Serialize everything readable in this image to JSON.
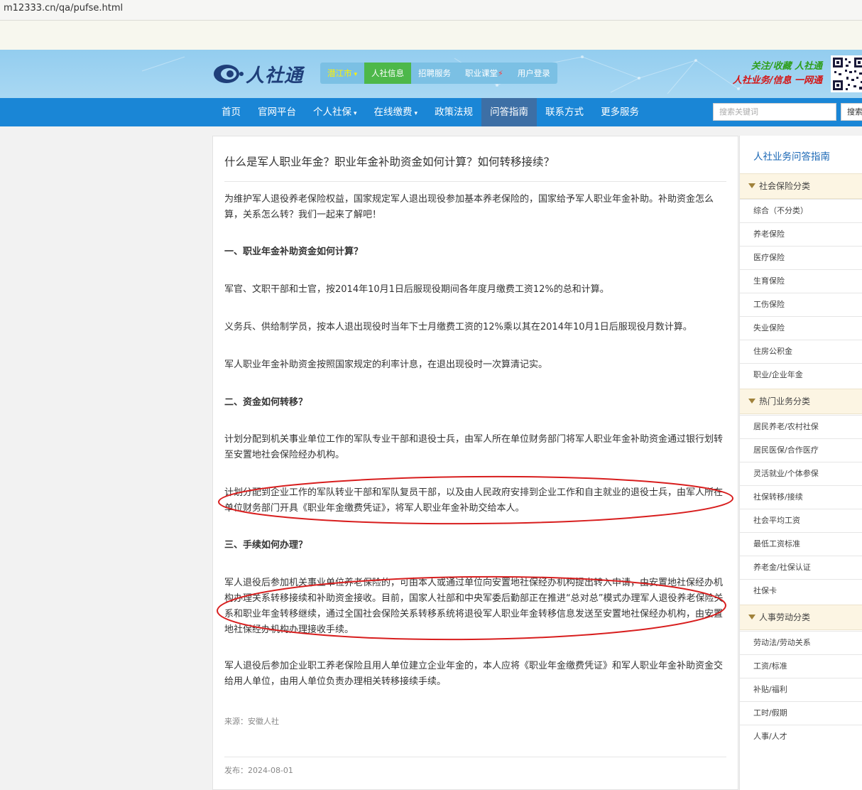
{
  "browser": {
    "url": "m12333.cn/qa/pufse.html"
  },
  "header": {
    "logo_text": "人社通",
    "top_nav": [
      {
        "label": "潜江市"
      },
      {
        "label": "人社信息"
      },
      {
        "label": "招聘服务"
      },
      {
        "label": "职业课堂"
      },
      {
        "label": "用户登录"
      }
    ],
    "slogan_line1": "关注/收藏 人社通",
    "slogan_line2": "人社业务/信息 一网通"
  },
  "nav": {
    "items": [
      {
        "label": "首页"
      },
      {
        "label": "官网平台"
      },
      {
        "label": "个人社保"
      },
      {
        "label": "在线缴费"
      },
      {
        "label": "政策法规"
      },
      {
        "label": "问答指南"
      },
      {
        "label": "联系方式"
      },
      {
        "label": "更多服务"
      }
    ],
    "search_placeholder": "搜索关键词",
    "search_button": "搜索"
  },
  "article": {
    "title": "什么是军人职业年金？职业年金补助资金如何计算？如何转移接续？",
    "intro": "为维护军人退役养老保险权益，国家规定军人退出现役参加基本养老保险的，国家给予军人职业年金补助。补助资金怎么算，关系怎么转？我们一起来了解吧！",
    "heading1": "一、职业年金补助资金如何计算？",
    "p1": "军官、文职干部和士官，按2014年10月1日后服现役期间各年度月缴费工资12%的总和计算。",
    "p2": "义务兵、供给制学员，按本人退出现役时当年下士月缴费工资的12%乘以其在2014年10月1日后服现役月数计算。",
    "p3": "军人职业年金补助资金按照国家规定的利率计息，在退出现役时一次算清记实。",
    "heading2": "二、资金如何转移？",
    "p4": "计划分配到机关事业单位工作的军队专业干部和退役士兵，由军人所在单位财务部门将军人职业年金补助资金通过银行划转至安置地社会保险经办机构。",
    "p5": "计划分配到企业工作的军队转业干部和军队复员干部，以及由人民政府安排到企业工作和自主就业的退役士兵，由军人所在单位财务部门开具《职业年金缴费凭证》，将军人职业年金补助交给本人。",
    "heading3": "三、手续如何办理？",
    "p6": "军人退役后参加机关事业单位养老保险的，可由本人或通过单位向安置地社保经办机构提出转入申请，由安置地社保经办机构办理关系转移接续和补助资金接收。目前，国家人社部和中央军委后勤部正在推进“总对总”模式办理军人退役养老保险关系和职业年金转移继续，通过全国社会保险关系转移系统将退役军人职业年金转移信息发送至安置地社保经办机构，由安置地社保经办机构办理接收手续。",
    "p7": "军人退役后参加企业职工养老保险且用人单位建立企业年金的，本人应将《职业年金缴费凭证》和军人职业年金补助资金交给用人单位，由用人单位负责办理相关转移接续手续。",
    "source": "来源：安徽人社",
    "date": "发布：2024-08-01"
  },
  "sidebar": {
    "title": "人社业务问答指南",
    "cat1": "社会保险分类",
    "cat1_items": [
      "综合（不分类）",
      "养老保险",
      "医疗保险",
      "生育保险",
      "工伤保险",
      "失业保险",
      "住房公积金",
      "职业/企业年金"
    ],
    "cat2": "热门业务分类",
    "cat2_items": [
      "居民养老/农村社保",
      "居民医保/合作医疗",
      "灵活就业/个体参保",
      "社保转移/接续",
      "社会平均工资",
      "最低工资标准",
      "养老金/社保认证",
      "社保卡"
    ],
    "cat3": "人事劳动分类",
    "cat3_items": [
      "劳动法/劳动关系",
      "工资/标准",
      "补贴/福利",
      "工时/假期",
      "人事/人才"
    ]
  },
  "colors": {
    "header_bg": "#a9d8f3",
    "nav_bg": "#1a86d6",
    "nav_active": "#3d6fa5",
    "annotation": "#d81e1e",
    "sidebar_title": "#1a67b5"
  }
}
